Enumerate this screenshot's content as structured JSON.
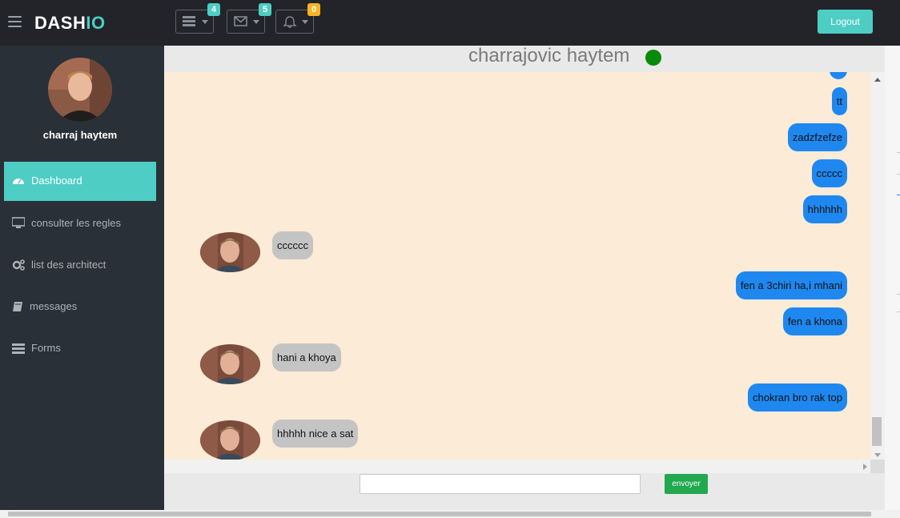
{
  "header": {
    "logo_main": "DASH",
    "logo_accent": "IO",
    "badges": {
      "tasks": "4",
      "messages": "5",
      "notifications": "0"
    },
    "logout_label": "Logout"
  },
  "sidebar": {
    "profile_name": "charraj haytem",
    "items": [
      {
        "label": "Dashboard",
        "icon": "dashboard-icon"
      },
      {
        "label": "consulter les regles",
        "icon": "desktop-icon"
      },
      {
        "label": "list des architect",
        "icon": "cogs-icon"
      },
      {
        "label": "messages",
        "icon": "book-icon"
      },
      {
        "label": "Forms",
        "icon": "tasks-icon"
      }
    ]
  },
  "chat": {
    "title": "charrajovic haytem",
    "status": "online",
    "messages": [
      {
        "from": "me",
        "text": "tt"
      },
      {
        "from": "me",
        "text": "zadzfzefze"
      },
      {
        "from": "me",
        "text": "ccccc"
      },
      {
        "from": "me",
        "text": "hhhhhh"
      },
      {
        "from": "them",
        "text": "cccccc"
      },
      {
        "from": "me",
        "text": "fen a 3chiri ha,i mhani"
      },
      {
        "from": "me",
        "text": "fen a khona"
      },
      {
        "from": "them",
        "text": "hani a khoya"
      },
      {
        "from": "me",
        "text": "chokran bro rak top"
      },
      {
        "from": "them",
        "text": "hhhhh nice a sat"
      }
    ],
    "input_value": "",
    "send_label": "envoyer"
  },
  "colors": {
    "accent": "#4ecdc4",
    "header_bg": "#22242a",
    "sidebar_bg": "#2a3037",
    "chat_bg": "#fbebd7",
    "sent_bubble": "#1e88f0",
    "recv_bubble": "#c4c4c4",
    "online": "#0a8a0a",
    "send_button": "#22a84f",
    "badge_yellow": "#fcb322"
  }
}
